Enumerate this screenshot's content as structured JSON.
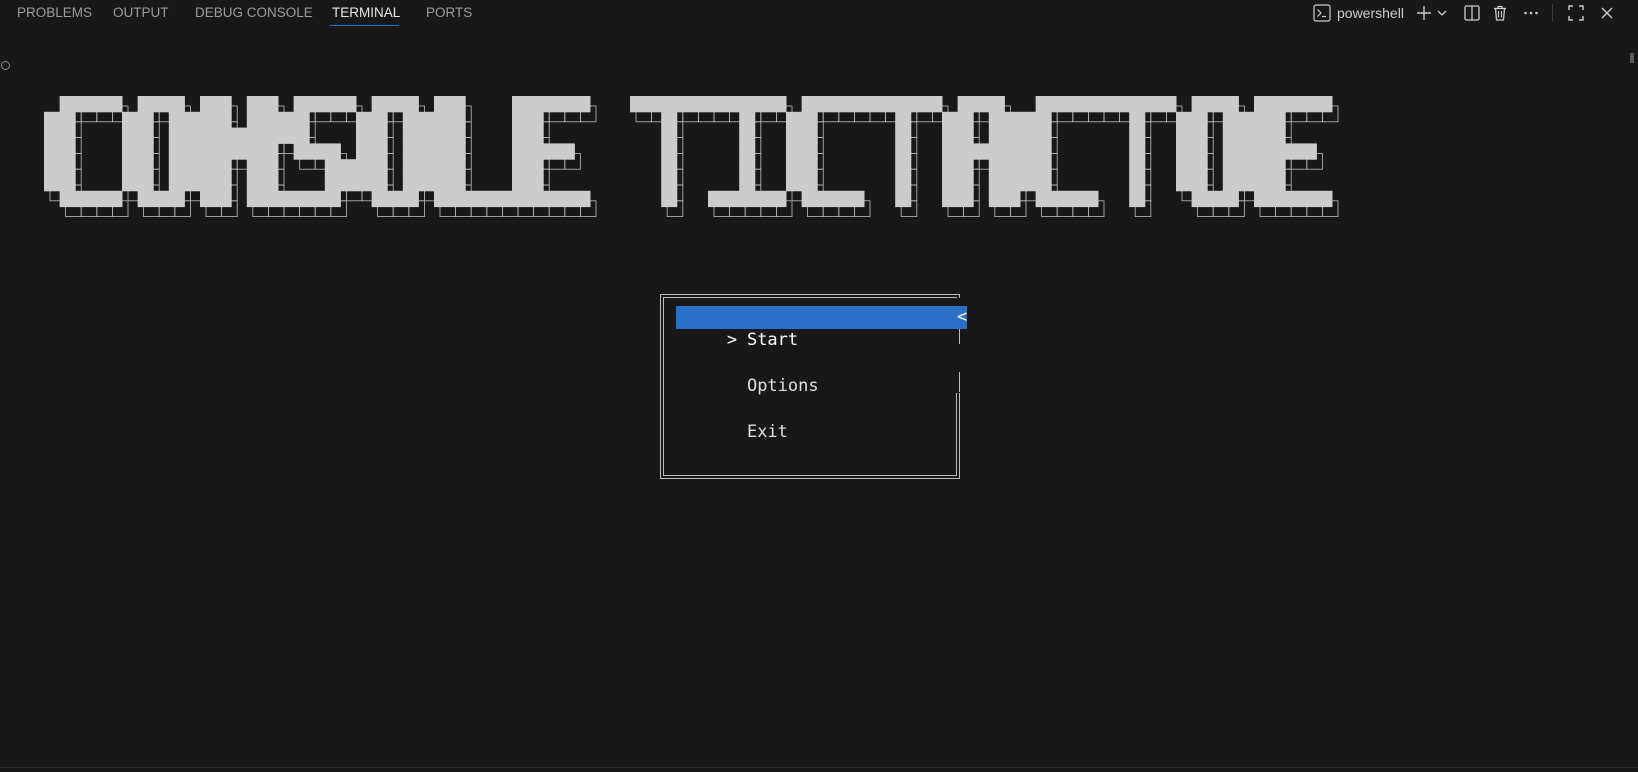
{
  "panel": {
    "tabs": [
      {
        "label": "PROBLEMS"
      },
      {
        "label": "OUTPUT"
      },
      {
        "label": "DEBUG CONSOLE"
      },
      {
        "label": "TERMINAL"
      },
      {
        "label": "PORTS"
      }
    ],
    "active_tab": "TERMINAL",
    "accent_color": "#0078d4"
  },
  "toolbar": {
    "shell_name": "powershell",
    "icons": [
      "terminal-icon",
      "plus-icon",
      "chevron-down-icon",
      "split-icon",
      "trash-icon",
      "more-icon",
      "maximize-icon",
      "close-icon"
    ]
  },
  "terminal": {
    "banner_text": "CONSOLE TICTACTOE",
    "menu": {
      "items": [
        {
          "label": "Start",
          "selected": true,
          "caret": ">",
          "end_mark": "<"
        },
        {
          "label": "Options",
          "selected": false
        },
        {
          "label": "Exit",
          "selected": false
        }
      ],
      "highlight_color": "#2a70c9"
    }
  }
}
